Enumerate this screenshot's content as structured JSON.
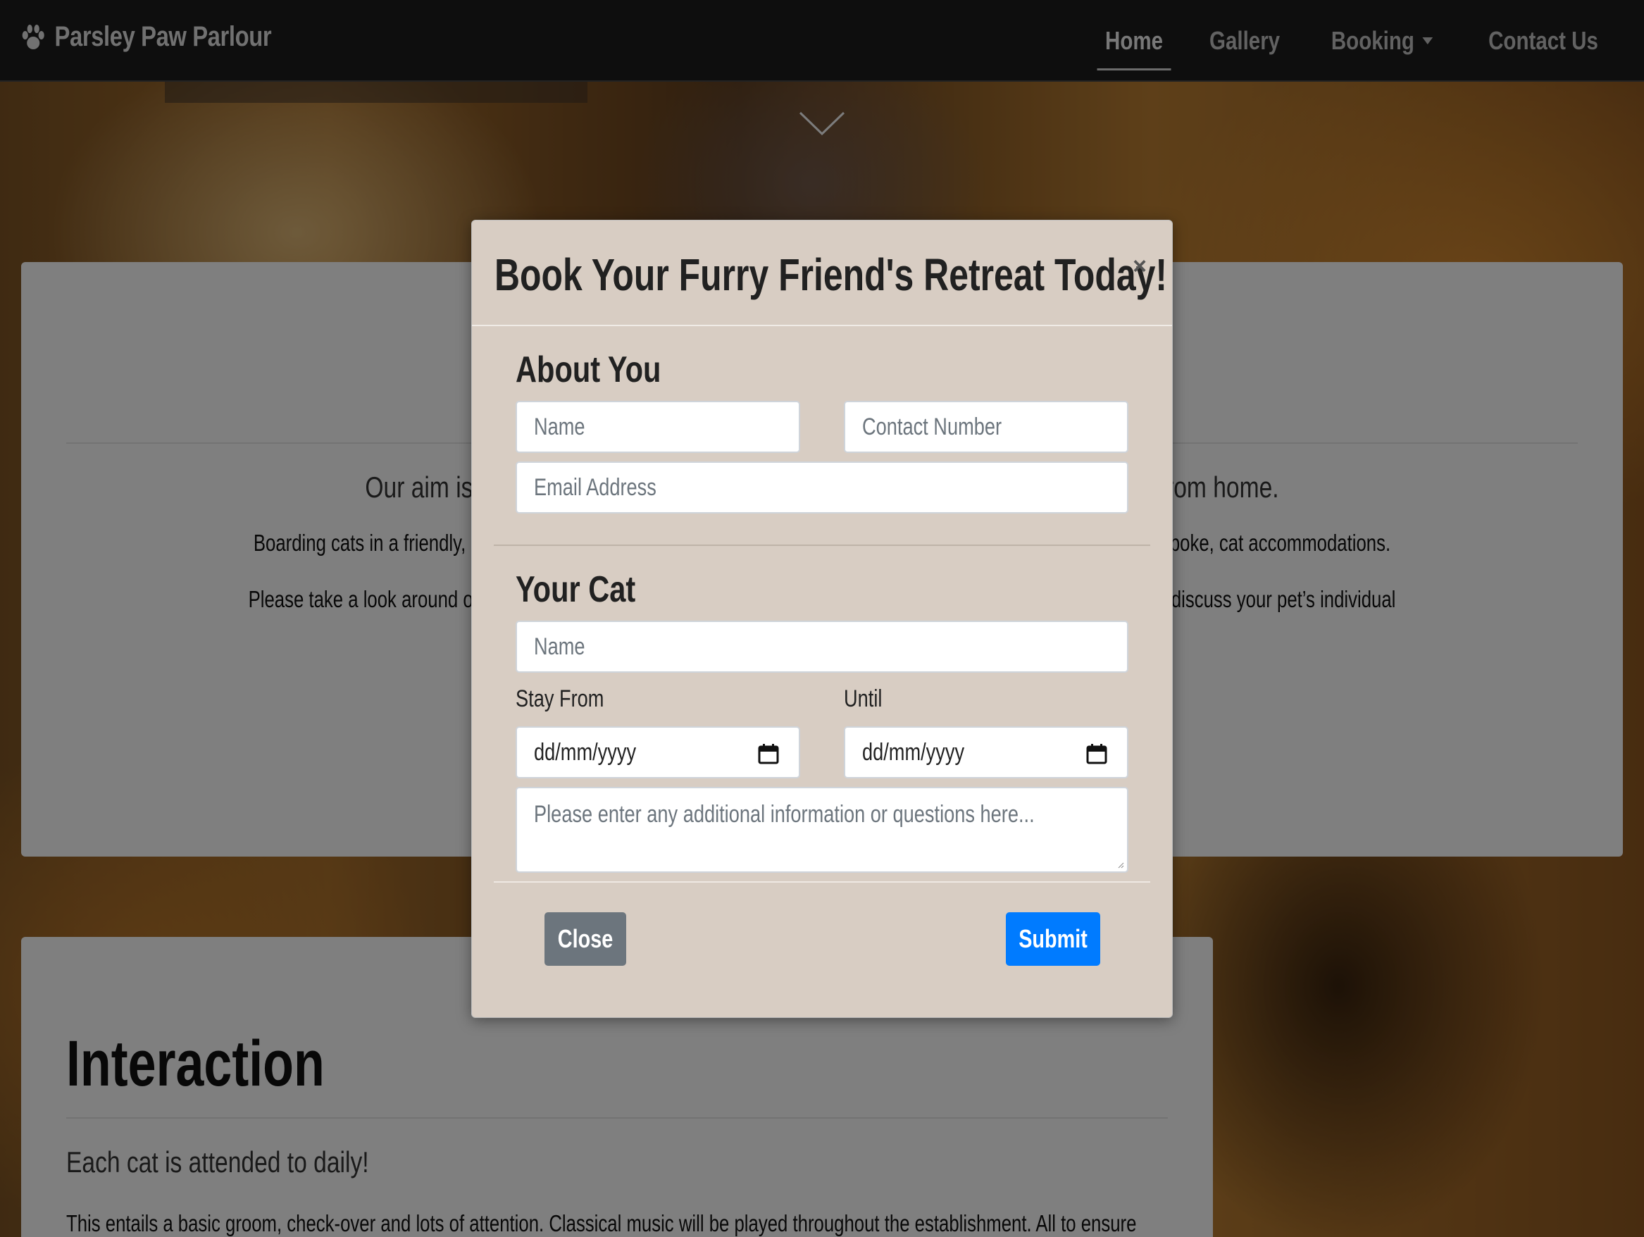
{
  "navbar": {
    "brand": "Parsley Paw Parlour",
    "brand_icon": "paw-icon",
    "links": [
      {
        "label": "Home",
        "active": true
      },
      {
        "label": "Gallery",
        "active": false
      },
      {
        "label": "Booking",
        "active": false,
        "dropdown": true
      },
      {
        "label": "Contact Us",
        "active": false
      }
    ]
  },
  "background": {
    "aim_text": "Our aim is to p                                                                                                      ay from home.",
    "aim_left": "Our aim is to p",
    "aim_right": "ay from home.",
    "para1_left": "Boarding cats in a friendly, secure e",
    "para1_right": "v our bespoke, cat accommodations.",
    "para2_left": "Please take a look around our site to find out",
    "para2_right": "to discuss your pet’s individual requirements.",
    "interaction_title": "Interaction",
    "interaction_sub": "Each cat is attended to daily!",
    "interaction_body": "This entails a basic groom, check-over and lots of attention. Classical music will be played throughout the establishment. All to ensure"
  },
  "modal": {
    "title": "Book Your Furry Friend's Retreat Today!",
    "close_symbol": "×",
    "about_you": {
      "heading": "About You",
      "name_placeholder": "Name",
      "contact_placeholder": "Contact Number",
      "email_placeholder": "Email Address"
    },
    "your_cat": {
      "heading": "Your Cat",
      "name_placeholder": "Name",
      "stay_from_label": "Stay From",
      "until_label": "Until",
      "stay_from_value": "dd/mm/yyyy",
      "until_value": "dd/mm/yyyy",
      "info_placeholder": "Please enter any additional information or questions here..."
    },
    "close_button": "Close",
    "submit_button": "Submit"
  },
  "colors": {
    "navbar_bg": "#1b1b1b",
    "modal_bg": "#d8cdc3",
    "submit_bg": "#007bff",
    "close_bg": "#6c757d"
  }
}
